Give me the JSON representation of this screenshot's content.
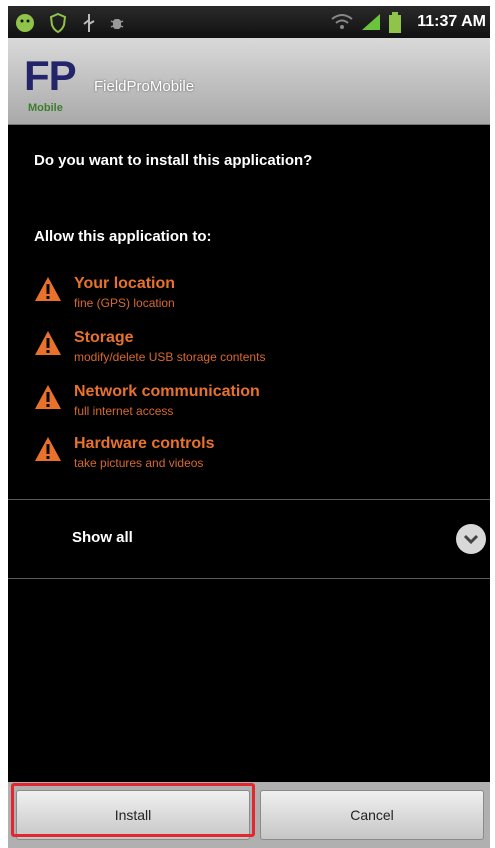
{
  "status_bar": {
    "time": "11:37 AM",
    "icons": [
      "android-icon",
      "shield-icon",
      "usb-icon",
      "debug-icon",
      "wifi-icon",
      "signal-icon",
      "battery-icon"
    ]
  },
  "app": {
    "logo_text": "FP",
    "logo_subtext": "Mobile",
    "name": "FieldProMobile"
  },
  "install": {
    "question": "Do you want to install this application?",
    "allow_label": "Allow this application to:",
    "permissions": [
      {
        "title": "Your location",
        "description": "fine (GPS) location"
      },
      {
        "title": "Storage",
        "description": "modify/delete USB storage contents"
      },
      {
        "title": "Network communication",
        "description": "full internet access"
      },
      {
        "title": "Hardware controls",
        "description": "take pictures and videos"
      }
    ],
    "show_all_label": "Show all"
  },
  "buttons": {
    "install": "Install",
    "cancel": "Cancel"
  },
  "colors": {
    "warning": "#e8722c",
    "highlight": "#e0282e",
    "logo": "#24246a",
    "logo_sub": "#3d7d2e"
  }
}
